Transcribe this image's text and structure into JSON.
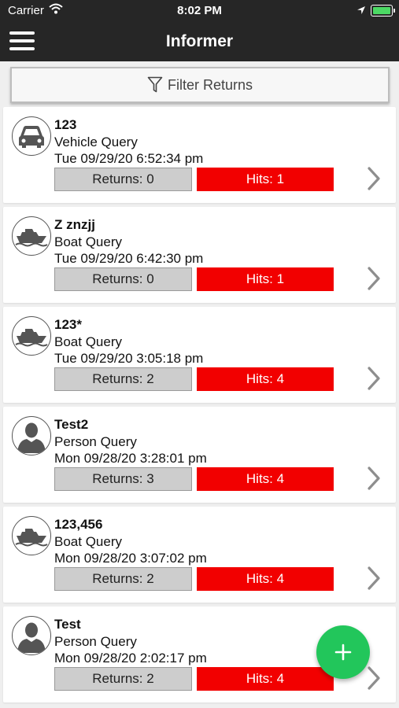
{
  "status_bar": {
    "carrier": "Carrier",
    "time": "8:02 PM"
  },
  "nav": {
    "title": "Informer"
  },
  "filter": {
    "label": "Filter Returns"
  },
  "queries": [
    {
      "icon": "car-icon",
      "name": "123",
      "type": "Vehicle Query",
      "date": "Tue 09/29/20 6:52:34 pm",
      "returns": "Returns: 0",
      "hits": "Hits: 1"
    },
    {
      "icon": "boat-icon",
      "name": "Z znzjj",
      "type": "Boat Query",
      "date": "Tue 09/29/20 6:42:30 pm",
      "returns": "Returns: 0",
      "hits": "Hits: 1"
    },
    {
      "icon": "boat-icon",
      "name": "123*",
      "type": "Boat Query",
      "date": "Tue 09/29/20 3:05:18 pm",
      "returns": "Returns: 2",
      "hits": "Hits: 4"
    },
    {
      "icon": "person-icon",
      "name": "Test2",
      "type": "Person Query",
      "date": "Mon 09/28/20 3:28:01 pm",
      "returns": "Returns: 3",
      "hits": "Hits: 4"
    },
    {
      "icon": "boat-icon",
      "name": "123,456",
      "type": "Boat Query",
      "date": "Mon 09/28/20 3:07:02 pm",
      "returns": "Returns: 2",
      "hits": "Hits: 4"
    },
    {
      "icon": "person-icon",
      "name": "Test",
      "type": "Person Query",
      "date": "Mon 09/28/20 2:02:17 pm",
      "returns": "Returns: 2",
      "hits": "Hits: 4"
    }
  ],
  "colors": {
    "bar": "#262626",
    "hits": "#f20000",
    "returns": "#cdcdcd",
    "fab": "#22c65b"
  }
}
